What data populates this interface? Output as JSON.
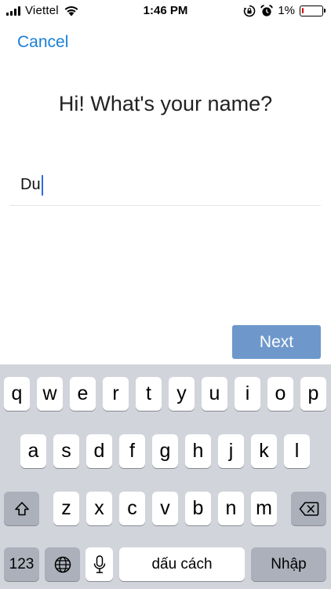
{
  "status_bar": {
    "carrier": "Viettel",
    "time": "1:46 PM",
    "battery_percent": "1%",
    "icons": [
      "signal-icon",
      "wifi-icon",
      "rotation-lock-icon",
      "alarm-icon",
      "battery-icon"
    ]
  },
  "nav": {
    "cancel_label": "Cancel"
  },
  "main": {
    "title": "Hi! What's your name?",
    "name_value": "Du",
    "next_label": "Next"
  },
  "keyboard": {
    "row1": [
      "q",
      "w",
      "e",
      "r",
      "t",
      "y",
      "u",
      "i",
      "o",
      "p"
    ],
    "row2": [
      "a",
      "s",
      "d",
      "f",
      "g",
      "h",
      "j",
      "k",
      "l"
    ],
    "row3": [
      "z",
      "x",
      "c",
      "v",
      "b",
      "n",
      "m"
    ],
    "numbers_label": "123",
    "space_label": "dấu cách",
    "return_label": "Nhập",
    "icons": [
      "shift-icon",
      "backspace-icon",
      "globe-icon",
      "microphone-icon"
    ]
  },
  "colors": {
    "accent": "#1a7fd6",
    "next_button": "#6e98cb",
    "keyboard_bg": "#d1d4da",
    "caret": "#2b6de0"
  }
}
